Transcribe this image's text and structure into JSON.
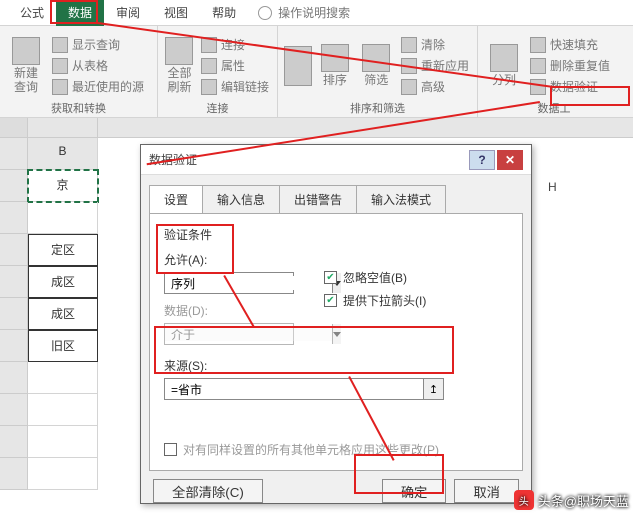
{
  "tabs": {
    "t1": "公式",
    "t2": "数据",
    "t3": "审阅",
    "t4": "视图",
    "t5": "帮助",
    "tellme": "操作说明搜索"
  },
  "ribbon": {
    "g1": {
      "big": "新建\n查询",
      "s1": "显示查询",
      "s2": "从表格",
      "s3": "最近使用的源",
      "label": "获取和转换"
    },
    "g2": {
      "big": "全部\n刷新",
      "s1": "连接",
      "s2": "属性",
      "s3": "编辑链接",
      "label": "连接"
    },
    "g3": {
      "b1": "排序",
      "b2": "筛选",
      "s1": "清除",
      "s2": "重新应用",
      "s3": "高级",
      "label": "排序和筛选"
    },
    "g4": {
      "big": "分列",
      "s1": "快速填充",
      "s2": "删除重复值",
      "s3": "数据验证",
      "label": "数据工"
    }
  },
  "cells": {
    "c1": "京",
    "c2": "定区",
    "c3": "成区",
    "c4": "成区",
    "c5": "旧区"
  },
  "cols": {
    "b": "B",
    "h": "H"
  },
  "dialog": {
    "title": "数据验证",
    "tabs": {
      "t1": "设置",
      "t2": "输入信息",
      "t3": "出错警告",
      "t4": "输入法模式"
    },
    "section": "验证条件",
    "allow_label": "允许(A):",
    "allow_value": "序列",
    "data_label": "数据(D):",
    "data_value": "介于",
    "chk1": "忽略空值(B)",
    "chk2": "提供下拉箭头(I)",
    "source_label": "来源(S):",
    "source_value": "=省市",
    "apply": "对有同样设置的所有其他单元格应用这些更改(P)",
    "clear": "全部清除(C)",
    "ok": "确定",
    "cancel": "取消"
  },
  "watermark": "头条@职场天蓝"
}
